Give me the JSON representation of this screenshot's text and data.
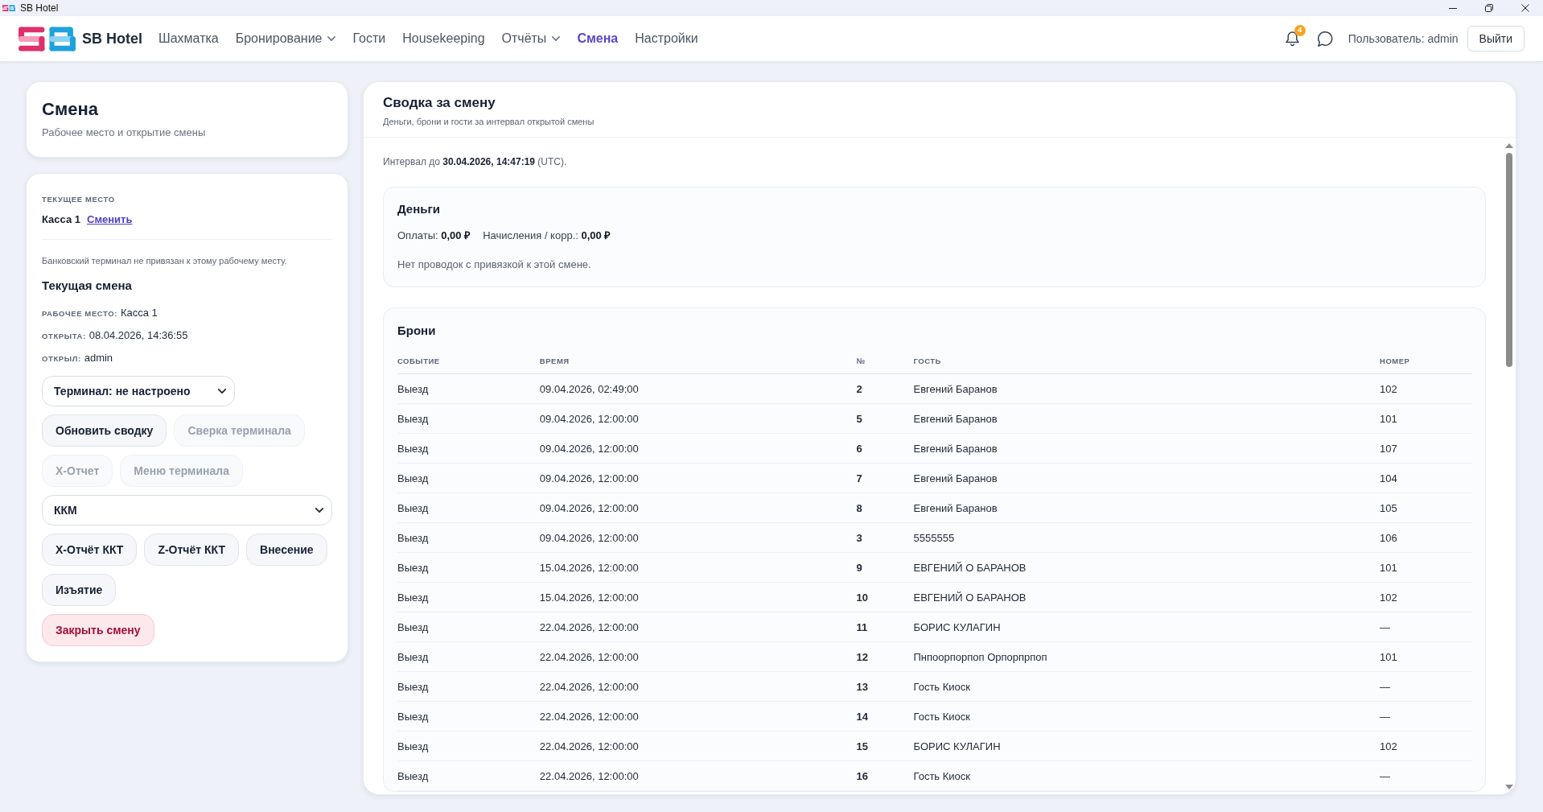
{
  "window": {
    "title": "SB Hotel"
  },
  "navbar": {
    "brand": "SB Hotel",
    "items": [
      {
        "label": "Шахматка",
        "selected": false,
        "has_menu": false
      },
      {
        "label": "Бронирование",
        "selected": false,
        "has_menu": true
      },
      {
        "label": "Гости",
        "selected": false,
        "has_menu": false
      },
      {
        "label": "Housekeeping",
        "selected": false,
        "has_menu": false
      },
      {
        "label": "Отчёты",
        "selected": false,
        "has_menu": true
      },
      {
        "label": "Смена",
        "selected": true,
        "has_menu": false
      },
      {
        "label": "Настройки",
        "selected": false,
        "has_menu": false
      }
    ],
    "notification_count": "4",
    "user": "Пользователь: admin",
    "logout": "Выйти"
  },
  "page_header": {
    "title": "Смена",
    "subtitle": "Рабочее место и открытие смены"
  },
  "workplace": {
    "current_place_label": "ТЕКУЩЕЕ МЕСТО",
    "current_place": "Касса 1",
    "change_link": "Сменить",
    "terminal_notice": "Банковский терминал не привязан к этому рабочему месту.",
    "shift_title": "Текущая смена",
    "shift_fields": [
      {
        "label": "РАБОЧЕЕ МЕСТО:",
        "value": "Касса 1"
      },
      {
        "label": "ОТКРЫТА:",
        "value": "08.04.2026, 14:36:55"
      },
      {
        "label": "ОТКРЫЛ:",
        "value": "admin"
      }
    ],
    "controls": [
      {
        "kind": "compact_select",
        "value": "Терминал: не настроено"
      },
      {
        "kind": "button_group",
        "buttons": [
          {
            "label": "Обновить сводку",
            "disabled": false
          },
          {
            "label": "Сверка терминала",
            "disabled": true
          },
          {
            "label": "Х-Отчет",
            "disabled": true
          },
          {
            "label": "Меню терминала",
            "disabled": true
          }
        ]
      },
      {
        "kind": "wide_select",
        "value": "ККМ"
      },
      {
        "kind": "button_group",
        "buttons": [
          {
            "label": "Х-Отчёт ККТ",
            "disabled": false
          },
          {
            "label": "Z-Отчёт ККТ",
            "disabled": false
          },
          {
            "label": "Внесение",
            "disabled": false
          },
          {
            "label": "Изъятие",
            "disabled": false
          }
        ]
      },
      {
        "kind": "danger_button",
        "label": "Закрыть смену"
      }
    ]
  },
  "summary": {
    "title": "Сводка за смену",
    "subtitle": "Деньги, брони и гости за интервал открытой смены",
    "interval": "Интервал до **30.04.2026, 14:47:19** (UTC).",
    "money": {
      "title": "Деньги",
      "totals": [
        "Оплаты: **0,00 ₽**",
        "Начисления / корр.: **0,00 ₽**"
      ],
      "note": "Нет проводок с привязкой к этой смене."
    },
    "bookings": {
      "title": "Брони",
      "columns": [
        "СОБЫТИЕ",
        "ВРЕМЯ",
        "№",
        "ГОСТЬ",
        "НОМЕР"
      ],
      "rows": [
        {
          "event": "Выезд",
          "time": "09.04.2026, 02:49:00",
          "number": "2",
          "guest": "Евгений Баранов",
          "room": "102"
        },
        {
          "event": "Выезд",
          "time": "09.04.2026, 12:00:00",
          "number": "5",
          "guest": "Евгений Баранов",
          "room": "101"
        },
        {
          "event": "Выезд",
          "time": "09.04.2026, 12:00:00",
          "number": "6",
          "guest": "Евгений Баранов",
          "room": "107"
        },
        {
          "event": "Выезд",
          "time": "09.04.2026, 12:00:00",
          "number": "7",
          "guest": "Евгений Баранов",
          "room": "104"
        },
        {
          "event": "Выезд",
          "time": "09.04.2026, 12:00:00",
          "number": "8",
          "guest": "Евгений Баранов",
          "room": "105"
        },
        {
          "event": "Выезд",
          "time": "09.04.2026, 12:00:00",
          "number": "3",
          "guest": "5555555",
          "room": "106"
        },
        {
          "event": "Выезд",
          "time": "15.04.2026, 12:00:00",
          "number": "9",
          "guest": "ЕВГЕНИЙ О БАРАНОВ",
          "room": "101"
        },
        {
          "event": "Выезд",
          "time": "15.04.2026, 12:00:00",
          "number": "10",
          "guest": "ЕВГЕНИЙ О БАРАНОВ",
          "room": "102"
        },
        {
          "event": "Выезд",
          "time": "22.04.2026, 12:00:00",
          "number": "11",
          "guest": "БОРИС КУЛАГИН",
          "room": "—"
        },
        {
          "event": "Выезд",
          "time": "22.04.2026, 12:00:00",
          "number": "12",
          "guest": "Пнпоорпорпоп Орпорпрпоп",
          "room": "101"
        },
        {
          "event": "Выезд",
          "time": "22.04.2026, 12:00:00",
          "number": "13",
          "guest": "Гость Киоск",
          "room": "—"
        },
        {
          "event": "Выезд",
          "time": "22.04.2026, 12:00:00",
          "number": "14",
          "guest": "Гость Киоск",
          "room": "—"
        },
        {
          "event": "Выезд",
          "time": "22.04.2026, 12:00:00",
          "number": "15",
          "guest": "БОРИС КУЛАГИН",
          "room": "102"
        },
        {
          "event": "Выезд",
          "time": "22.04.2026, 12:00:00",
          "number": "16",
          "guest": "Гость Киоск",
          "room": "—"
        }
      ]
    }
  }
}
